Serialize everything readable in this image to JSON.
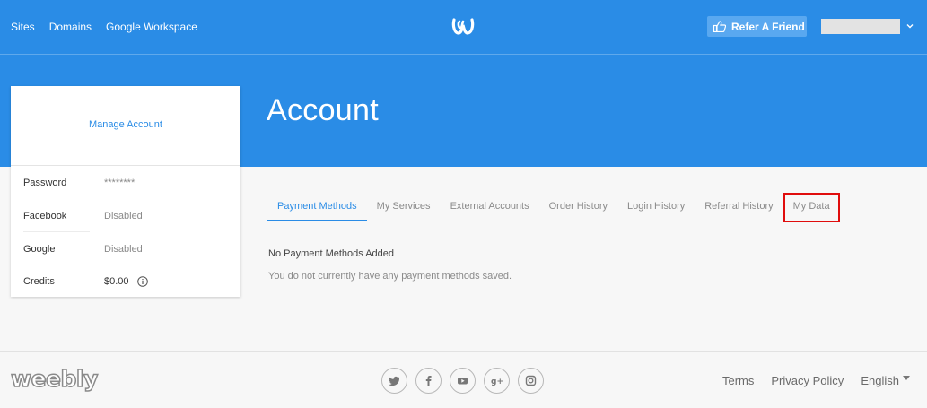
{
  "header": {
    "nav": [
      "Sites",
      "Domains",
      "Google Workspace"
    ],
    "logo_icon": "weebly-w-icon",
    "refer_label": "Refer A Friend",
    "page_title": "Account"
  },
  "card": {
    "manage_label": "Manage Account",
    "rows": [
      {
        "label": "Password",
        "value": "********"
      },
      {
        "label": "Facebook",
        "value": "Disabled"
      },
      {
        "label": "Google",
        "value": "Disabled"
      },
      {
        "label": "Credits",
        "value": "$0.00"
      }
    ]
  },
  "tabs": [
    "Payment Methods",
    "My Services",
    "External Accounts",
    "Order History",
    "Login History",
    "Referral History",
    "My Data"
  ],
  "active_tab": "Payment Methods",
  "highlighted_tab": "My Data",
  "content": {
    "title": "No Payment Methods Added",
    "text": "You do not currently have any payment methods saved."
  },
  "footer": {
    "logo": "weebly",
    "socials": [
      "twitter-icon",
      "facebook-icon",
      "youtube-icon",
      "google-plus-icon",
      "instagram-icon"
    ],
    "terms": "Terms",
    "privacy": "Privacy Policy",
    "language": "English"
  },
  "colors": {
    "brand_blue": "#2a8ce6",
    "highlight_red": "#e00d0d"
  }
}
